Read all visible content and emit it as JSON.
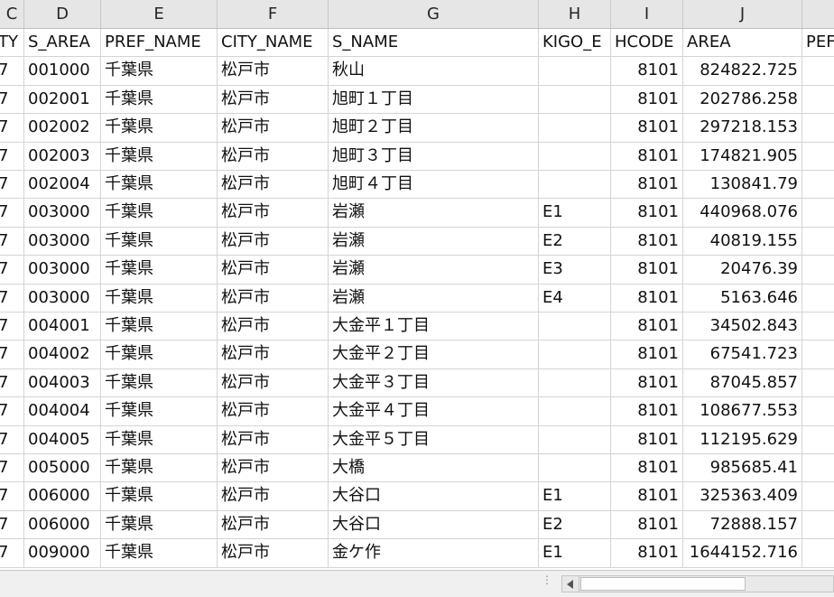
{
  "column_letters": [
    "C",
    "D",
    "E",
    "F",
    "G",
    "H",
    "I",
    "J",
    ""
  ],
  "field_headers": [
    "TY",
    "S_AREA",
    "PREF_NAME",
    "CITY_NAME",
    "S_NAME",
    "KIGO_E",
    "HCODE",
    "AREA",
    "PEF"
  ],
  "rows": [
    [
      "7",
      "001000",
      "千葉県",
      "松戸市",
      "秋山",
      "",
      "8101",
      "824822.725"
    ],
    [
      "7",
      "002001",
      "千葉県",
      "松戸市",
      "旭町１丁目",
      "",
      "8101",
      "202786.258"
    ],
    [
      "7",
      "002002",
      "千葉県",
      "松戸市",
      "旭町２丁目",
      "",
      "8101",
      "297218.153"
    ],
    [
      "7",
      "002003",
      "千葉県",
      "松戸市",
      "旭町３丁目",
      "",
      "8101",
      "174821.905"
    ],
    [
      "7",
      "002004",
      "千葉県",
      "松戸市",
      "旭町４丁目",
      "",
      "8101",
      "130841.79"
    ],
    [
      "7",
      "003000",
      "千葉県",
      "松戸市",
      "岩瀬",
      "E1",
      "8101",
      "440968.076"
    ],
    [
      "7",
      "003000",
      "千葉県",
      "松戸市",
      "岩瀬",
      "E2",
      "8101",
      "40819.155"
    ],
    [
      "7",
      "003000",
      "千葉県",
      "松戸市",
      "岩瀬",
      "E3",
      "8101",
      "20476.39"
    ],
    [
      "7",
      "003000",
      "千葉県",
      "松戸市",
      "岩瀬",
      "E4",
      "8101",
      "5163.646"
    ],
    [
      "7",
      "004001",
      "千葉県",
      "松戸市",
      "大金平１丁目",
      "",
      "8101",
      "34502.843"
    ],
    [
      "7",
      "004002",
      "千葉県",
      "松戸市",
      "大金平２丁目",
      "",
      "8101",
      "67541.723"
    ],
    [
      "7",
      "004003",
      "千葉県",
      "松戸市",
      "大金平３丁目",
      "",
      "8101",
      "87045.857"
    ],
    [
      "7",
      "004004",
      "千葉県",
      "松戸市",
      "大金平４丁目",
      "",
      "8101",
      "108677.553"
    ],
    [
      "7",
      "004005",
      "千葉県",
      "松戸市",
      "大金平５丁目",
      "",
      "8101",
      "112195.629"
    ],
    [
      "7",
      "005000",
      "千葉県",
      "松戸市",
      "大橋",
      "",
      "8101",
      "985685.41"
    ],
    [
      "7",
      "006000",
      "千葉県",
      "松戸市",
      "大谷口",
      "E1",
      "8101",
      "325363.409"
    ],
    [
      "7",
      "006000",
      "千葉県",
      "松戸市",
      "大谷口",
      "E2",
      "8101",
      "72888.157"
    ],
    [
      "7",
      "009000",
      "千葉県",
      "松戸市",
      "金ケ作",
      "E1",
      "8101",
      "1644152.716"
    ]
  ],
  "icons": {
    "scroll_left": "triangle-left-icon",
    "split_handle": "vertical-dots-icon"
  }
}
